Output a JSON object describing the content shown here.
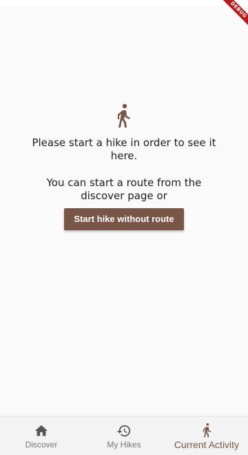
{
  "debug_banner": "DEBUG",
  "empty_state": {
    "icon": "hiker-icon",
    "message": "Please start a hike in order to see it here.",
    "secondary_message": "You can start a route from the discover page or",
    "start_button_label": "Start hike without route"
  },
  "bottom_nav": {
    "items": [
      {
        "label": "Discover",
        "icon": "home-icon",
        "active": false
      },
      {
        "label": "My Hikes",
        "icon": "history-icon",
        "active": false
      },
      {
        "label": "Current Activity",
        "icon": "hiker-icon",
        "active": true
      }
    ]
  },
  "colors": {
    "accent": "#795548",
    "inactive": "#757575",
    "debug_ribbon": "#b71c1c"
  }
}
